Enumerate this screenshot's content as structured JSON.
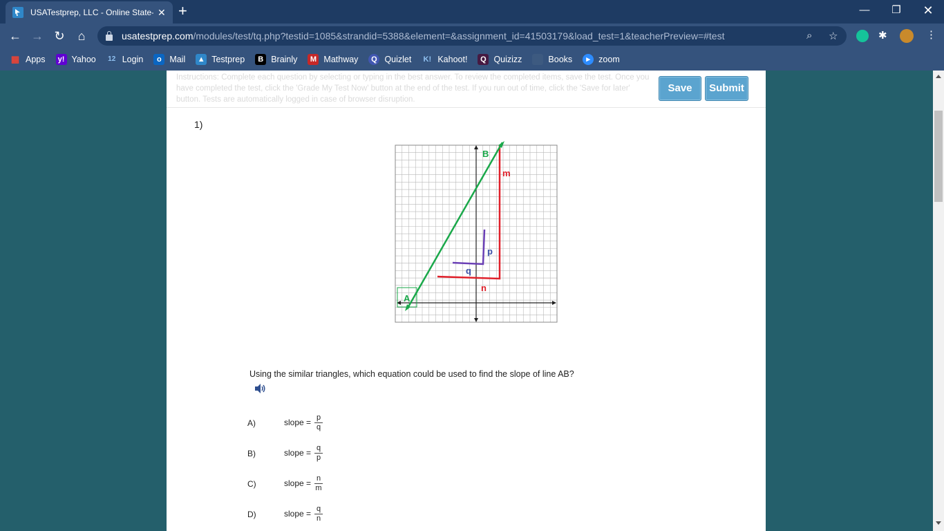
{
  "browser": {
    "tab_title": "USATestprep, LLC - Online State-",
    "url_host": "usatestprep.com",
    "url_path": "/modules/test/tq.php?testid=1085&strandid=5388&element=&assignment_id=41503179&load_test=1&teacherPreview=#test",
    "bookmarks": [
      {
        "label": "Apps",
        "icon": "apps-grid-icon",
        "color": "#4285f4"
      },
      {
        "label": "Yahoo",
        "icon": "yahoo-icon",
        "color": "#6001d2"
      },
      {
        "label": "Login",
        "icon": "login-icon",
        "color": "#3b78c2"
      },
      {
        "label": "Mail",
        "icon": "mail-icon",
        "color": "#0a66c2"
      },
      {
        "label": "Testprep",
        "icon": "testprep-icon",
        "color": "#2f87c9"
      },
      {
        "label": "Brainly",
        "icon": "brainly-icon",
        "color": "#000000"
      },
      {
        "label": "Mathway",
        "icon": "mathway-icon",
        "color": "#c62828"
      },
      {
        "label": "Quizlet",
        "icon": "quizlet-icon",
        "color": "#4257b2"
      },
      {
        "label": "Kahoot!",
        "icon": "kahoot-icon",
        "color": "#46178f"
      },
      {
        "label": "Quizizz",
        "icon": "quizizz-icon",
        "color": "#461a42"
      },
      {
        "label": "Books",
        "icon": "books-folder-icon",
        "color": "#3d5a80"
      },
      {
        "label": "zoom",
        "icon": "zoom-icon",
        "color": "#2d8cff"
      }
    ],
    "login_prefix": "12",
    "yahoo_mark": "y!",
    "brainly_mark": "B",
    "kahoot_mark": "K!",
    "quizizz_mark": "Q"
  },
  "test": {
    "instructions": "Instructions: Complete each question by selecting or typing in the best answer. To review the completed items, save the test. Once you have completed the test, click the 'Grade My Test Now' button at the end of the test. If you run out of time, click the 'Save for later' button. Tests are automatically logged in case of browser disruption.",
    "save_label": "Save",
    "submit_label": "Submit",
    "question_number": "1)",
    "question_text": "Using the similar triangles, which equation could be used to find the slope of line AB?",
    "graph_labels": {
      "A": "A",
      "B": "B",
      "m": "m",
      "p": "p",
      "q": "q",
      "n": "n"
    },
    "choices": [
      {
        "letter": "A)",
        "prefix": "slope =",
        "num": "p",
        "den": "q"
      },
      {
        "letter": "B)",
        "prefix": "slope =",
        "num": "q",
        "den": "p"
      },
      {
        "letter": "C)",
        "prefix": "slope =",
        "num": "n",
        "den": "m"
      },
      {
        "letter": "D)",
        "prefix": "slope =",
        "num": "q",
        "den": "n"
      }
    ]
  },
  "colors": {
    "line_ab": "#1aa84a",
    "triangle_large": "#e0202a",
    "triangle_small": "#6a3fb5",
    "accent_button": "#5ba4cf",
    "page_bg": "#245f6b"
  }
}
